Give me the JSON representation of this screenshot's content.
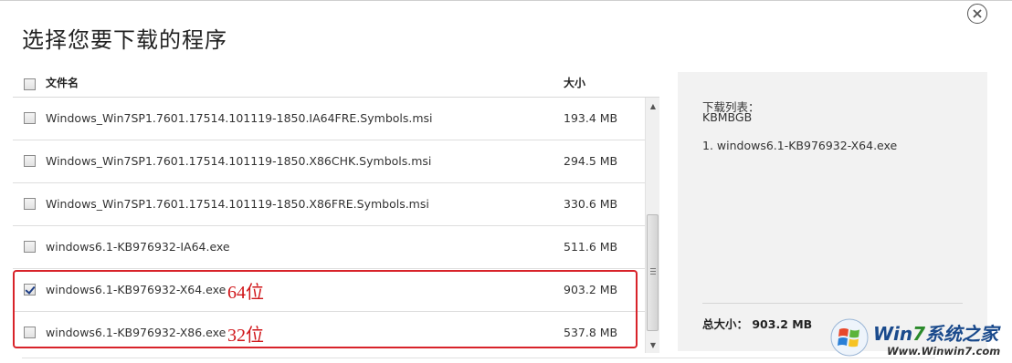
{
  "dialog": {
    "title": "选择您要下载的程序"
  },
  "list": {
    "header": {
      "name": "文件名",
      "size": "大小",
      "select_all_checked": false
    },
    "rows": [
      {
        "name": "Windows_Win7SP1.7601.17514.101119-1850.IA64FRE.Symbols.msi",
        "size": "193.4 MB",
        "checked": false,
        "annotation": ""
      },
      {
        "name": "Windows_Win7SP1.7601.17514.101119-1850.X86CHK.Symbols.msi",
        "size": "294.5 MB",
        "checked": false,
        "annotation": ""
      },
      {
        "name": "Windows_Win7SP1.7601.17514.101119-1850.X86FRE.Symbols.msi",
        "size": "330.6 MB",
        "checked": false,
        "annotation": ""
      },
      {
        "name": "windows6.1-KB976932-IA64.exe",
        "size": "511.6 MB",
        "checked": false,
        "annotation": ""
      },
      {
        "name": "windows6.1-KB976932-X64.exe",
        "size": "903.2 MB",
        "checked": true,
        "annotation": "64位"
      },
      {
        "name": "windows6.1-KB976932-X86.exe",
        "size": "537.8 MB",
        "checked": false,
        "annotation": "32位"
      }
    ]
  },
  "side_panel": {
    "title": "下载列表：",
    "code": "KBMBGB",
    "items": [
      "1. windows6.1-KB976932-X64.exe"
    ],
    "total_label": "总大小：",
    "total_value": "903.2 MB",
    "total_text": "总大小： 903.2 MB"
  },
  "watermark": {
    "brand_part1": "Win",
    "brand_accent": "7",
    "brand_part2": "系统之家",
    "url": "Www.Winwin7.com"
  },
  "colors": {
    "annotation_red": "#d0161a",
    "highlight_border": "#d8232a",
    "panel_bg": "#f2f2f2",
    "watermark_blue": "#1a4a8c",
    "watermark_green": "#2b8a2b"
  }
}
